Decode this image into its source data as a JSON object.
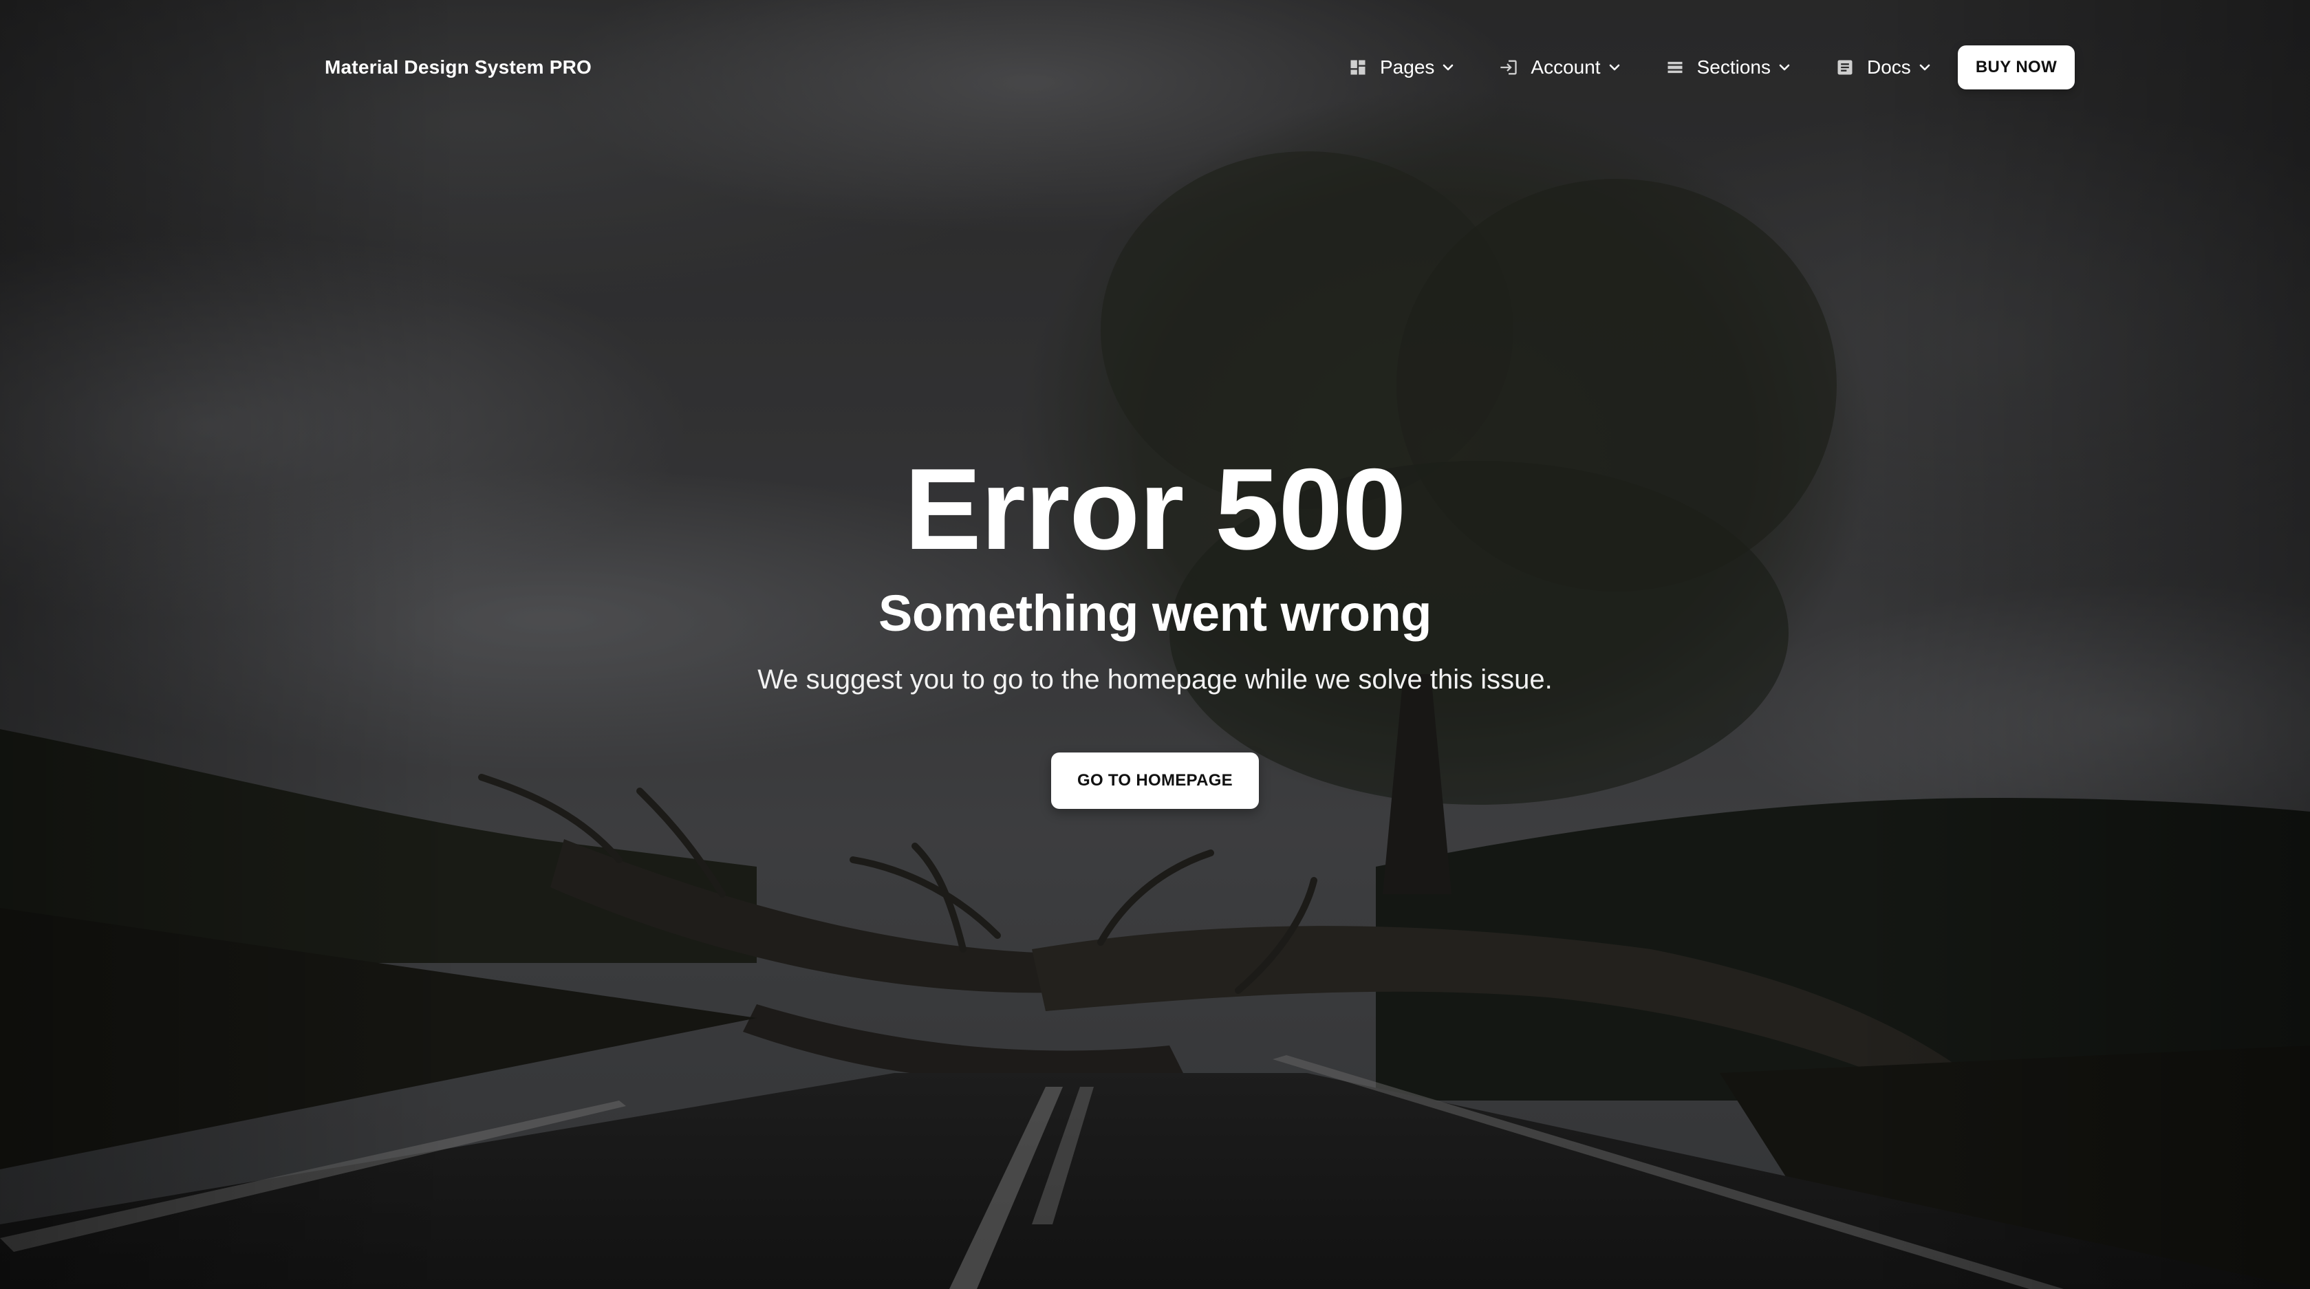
{
  "navbar": {
    "brand": "Material Design System PRO",
    "items": [
      {
        "label": "Pages",
        "icon": "dashboard-icon"
      },
      {
        "label": "Account",
        "icon": "login-icon"
      },
      {
        "label": "Sections",
        "icon": "view-list-icon"
      },
      {
        "label": "Docs",
        "icon": "article-icon"
      }
    ],
    "buy_label": "BUY NOW"
  },
  "hero": {
    "title": "Error 500",
    "subtitle": "Something went wrong",
    "description": "We suggest you to go to the homepage while we solve this issue.",
    "button_label": "GO TO HOMEPAGE"
  },
  "background": {
    "description_icon": "fallen-tree-storm-photo",
    "overlay_color": "#000000"
  }
}
